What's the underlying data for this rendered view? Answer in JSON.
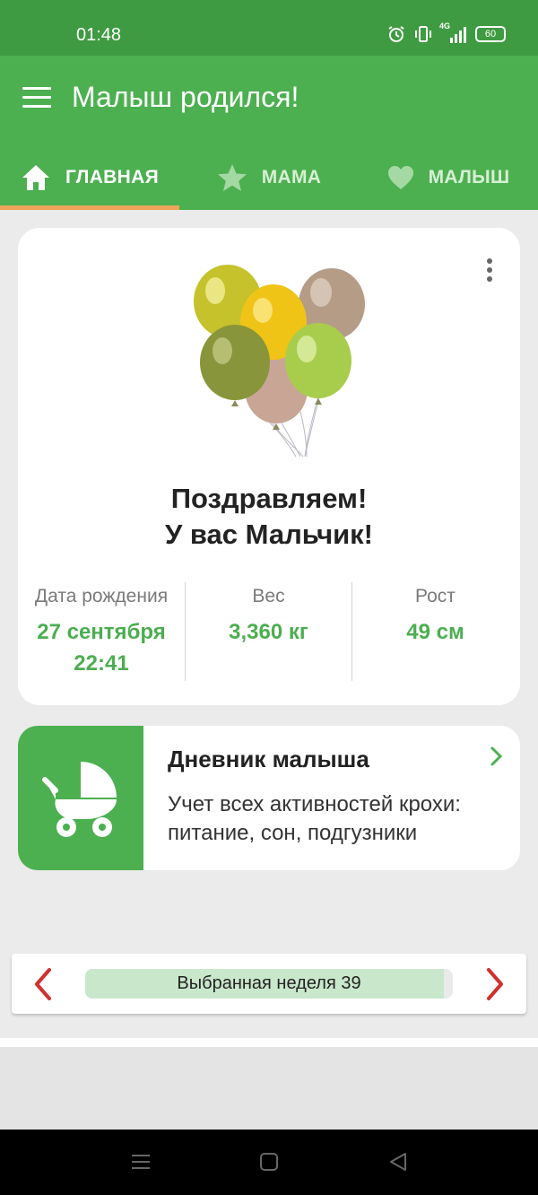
{
  "status_bar": {
    "time": "01:48",
    "network": "4G",
    "battery": "60"
  },
  "app_bar": {
    "title": "Малыш родился!"
  },
  "tabs": [
    {
      "label": "ГЛАВНАЯ",
      "icon": "home-icon",
      "active": true
    },
    {
      "label": "МАМА",
      "icon": "star-icon",
      "active": false
    },
    {
      "label": "МАЛЫШ",
      "icon": "heart-icon",
      "active": false
    }
  ],
  "birth_card": {
    "image": "balloons",
    "congrats_line1": "Поздравляем!",
    "congrats_line2": "У вас Мальчик!",
    "stats": [
      {
        "label": "Дата рождения",
        "value_line1": "27 сентября",
        "value_line2": "22:41"
      },
      {
        "label": "Вес",
        "value_line1": "3,360 кг",
        "value_line2": ""
      },
      {
        "label": "Рост",
        "value_line1": "49 см",
        "value_line2": ""
      }
    ]
  },
  "diary_card": {
    "title": "Дневник малыша",
    "description": "Учет всех активностей крохи: питание, сон, подгузники",
    "icon": "stroller-icon"
  },
  "week_selector": {
    "label": "Выбранная неделя 39",
    "week": 39,
    "progress": 0.975
  },
  "colors": {
    "primary": "#4cb050",
    "status_bar": "#3f9b41",
    "tab_indicator": "#f0a35a",
    "value_green": "#4cae50",
    "arrow_red": "#d32f2f"
  }
}
